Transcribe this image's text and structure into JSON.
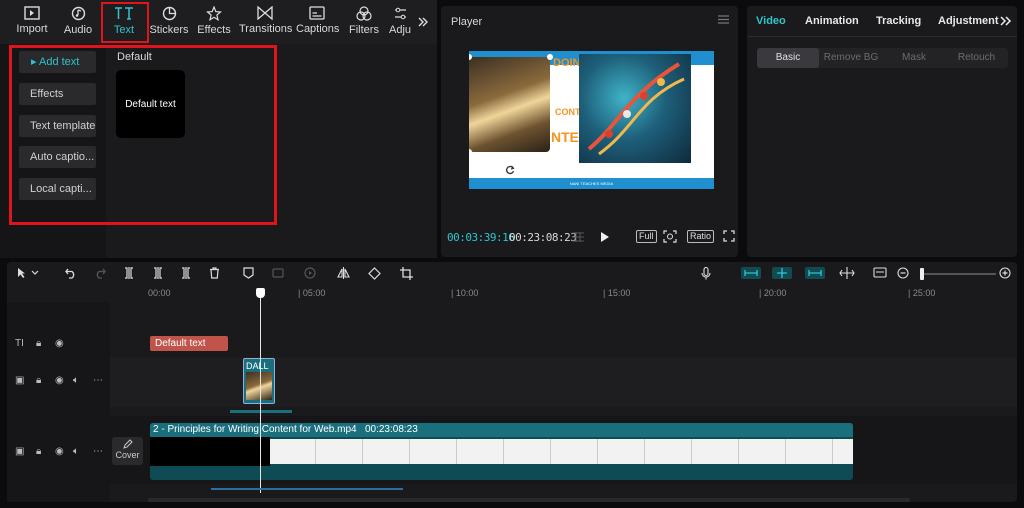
{
  "toolbar": {
    "tabs": [
      {
        "label": "Import",
        "icon": "import-icon"
      },
      {
        "label": "Audio",
        "icon": "audio-icon"
      },
      {
        "label": "Text",
        "icon": "text-icon",
        "active": true
      },
      {
        "label": "Stickers",
        "icon": "stickers-icon"
      },
      {
        "label": "Effects",
        "icon": "effects-icon"
      },
      {
        "label": "Transitions",
        "icon": "transitions-icon"
      },
      {
        "label": "Captions",
        "icon": "captions-icon"
      },
      {
        "label": "Filters",
        "icon": "filters-icon"
      },
      {
        "label": "Adju",
        "icon": "adjust-icon"
      }
    ],
    "more_icon": "double-chevron-right-icon"
  },
  "sidebar": {
    "items": [
      {
        "label": "Add text",
        "active": true
      },
      {
        "label": "Effects"
      },
      {
        "label": "Text template"
      },
      {
        "label": "Auto captio..."
      },
      {
        "label": "Local capti..."
      }
    ]
  },
  "text_panel": {
    "section_title": "Default",
    "card_label": "Default text"
  },
  "player": {
    "title": "Player",
    "time_current": "00:03:39:16",
    "time_total": "00:23:08:23",
    "full_label": "Full",
    "ratio_label": "Ratio",
    "video_frame": {
      "word1": "DOING",
      "word2": "CONTE",
      "word3": "NTEN",
      "footer": "NANI TEACHES MEDIA"
    }
  },
  "properties": {
    "tabs": [
      "Video",
      "Animation",
      "Tracking",
      "Adjustment"
    ],
    "active_tab": "Video",
    "subtabs": [
      "Basic",
      "Remove BG",
      "Mask",
      "Retouch"
    ],
    "active_subtab": "Basic"
  },
  "timeline": {
    "ruler": [
      "00:00",
      "05:00",
      "10:00",
      "15:00",
      "20:00",
      "25:00"
    ],
    "text_clip": "Default text",
    "dall_clip": "DALL",
    "main_clip_name": "2 -  Principles for Writing Content for Web.mp4",
    "main_clip_duration": "00:23:08:23",
    "cover_label": "Cover"
  },
  "colors": {
    "accent": "#2ec4cf",
    "highlight_red": "#e0141b",
    "text_clip": "#c0544a",
    "video_clip": "#1a6f7d"
  }
}
